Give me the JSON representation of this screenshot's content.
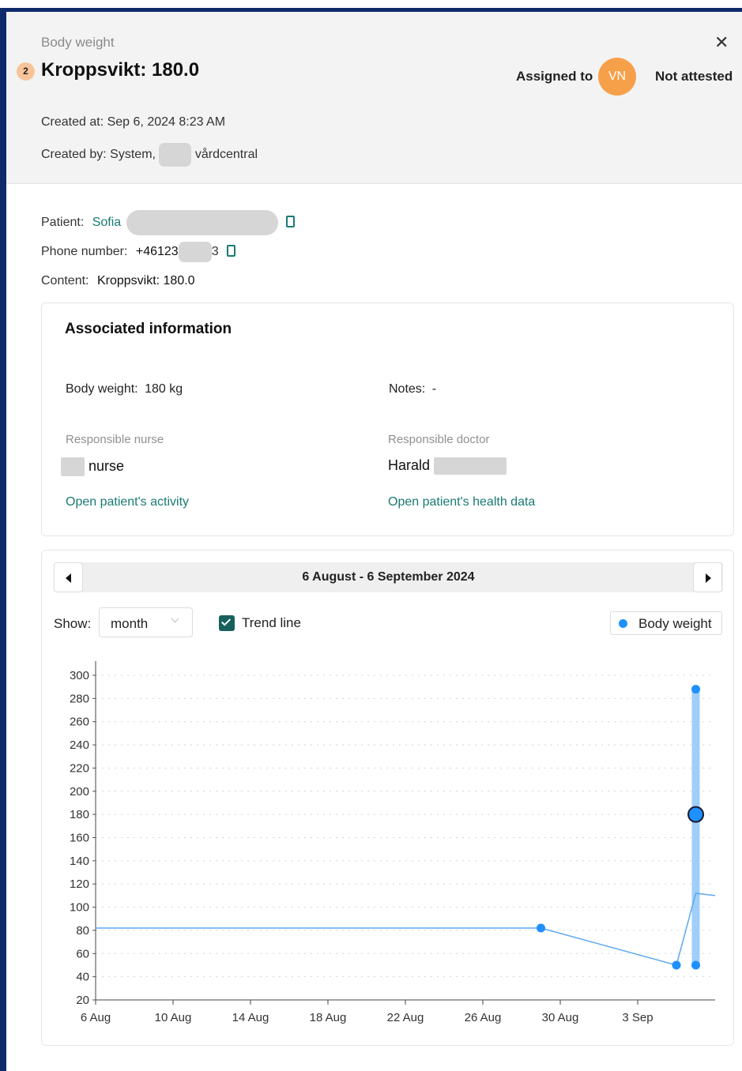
{
  "header": {
    "kind": "Body weight",
    "badge": "2",
    "title": "Kroppsvikt: 180.0",
    "assigned_label": "Assigned to",
    "assignee_initials": "VN",
    "attest_status": "Not attested",
    "created_at_label": "Created at:",
    "created_at": "Sep 6, 2024 8:23 AM",
    "created_by_label": "Created by:",
    "created_by_prefix": "System,",
    "created_by_suffix": "vårdcentral",
    "icons": {
      "close": "close-icon"
    }
  },
  "details": {
    "patient_label": "Patient:",
    "patient_name": "Sofia",
    "phone_label": "Phone number:",
    "phone": "+46123",
    "phone_end": "3",
    "content_label": "Content:",
    "content": "Kroppsvikt: 180.0",
    "icons": {
      "copy": "copy-icon"
    }
  },
  "associated": {
    "title": "Associated information",
    "body_weight_label": "Body weight",
    "body_weight": "180 kg",
    "notes_label": "Notes",
    "notes": "-",
    "nurse_label": "Responsible nurse",
    "nurse_name": "nurse",
    "doctor_label": "Responsible doctor",
    "doctor_name": "Harald",
    "activity_link": "Open patient's activity",
    "health_link": "Open patient's health data"
  },
  "chart_controls": {
    "range_label": "6 August - 6 September 2024",
    "show_label": "Show:",
    "period": "month",
    "trend_label": "Trend line",
    "trend_checked": true,
    "icons": {
      "prev": "caret-left-icon",
      "next": "caret-right-icon",
      "period": "chevron-down-icon",
      "check": "check-icon"
    }
  },
  "colors": {
    "accent": "#1a7a74",
    "point": "#1e90ff",
    "trend": "#5ca8f0",
    "range_band": "#8ec5f7",
    "avatar": "#f7a04a",
    "checkbox": "#17605c"
  },
  "chart_data": {
    "type": "scatter",
    "x_start": "2024-08-06",
    "x_end": "2024-09-07",
    "x_ticks": [
      "6 Aug",
      "10 Aug",
      "14 Aug",
      "18 Aug",
      "22 Aug",
      "26 Aug",
      "30 Aug",
      "3 Sep"
    ],
    "x_tick_dates": [
      "2024-08-06",
      "2024-08-10",
      "2024-08-14",
      "2024-08-18",
      "2024-08-22",
      "2024-08-26",
      "2024-08-30",
      "2024-09-03"
    ],
    "ylim": [
      20,
      300
    ],
    "y_ticks": [
      20,
      40,
      60,
      80,
      100,
      120,
      140,
      160,
      180,
      200,
      220,
      240,
      260,
      280,
      300
    ],
    "grid": true,
    "series": [
      {
        "name": "Body weight",
        "points": [
          {
            "x": "2024-08-29",
            "y": 82
          },
          {
            "x": "2024-09-05",
            "y": 50
          },
          {
            "x": "2024-09-06",
            "y": 288
          },
          {
            "x": "2024-09-06",
            "y": 50
          }
        ]
      }
    ],
    "range_band": {
      "x": "2024-09-06",
      "y_low": 50,
      "y_high": 288
    },
    "selected_point": {
      "x": "2024-09-06",
      "y": 180
    },
    "trend_line": [
      {
        "x": "2024-08-06",
        "y": 82
      },
      {
        "x": "2024-08-29",
        "y": 82
      },
      {
        "x": "2024-09-05",
        "y": 50
      },
      {
        "x": "2024-09-06",
        "y": 112
      },
      {
        "x": "2024-09-07",
        "y": 110
      }
    ]
  }
}
